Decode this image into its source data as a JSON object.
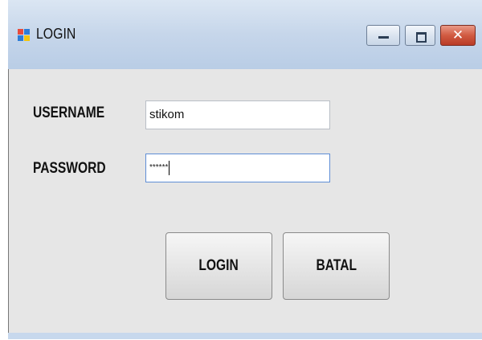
{
  "window": {
    "title": "LOGIN"
  },
  "form": {
    "username_label": "USERNAME",
    "username_value": "stikom",
    "password_label": "PASSWORD",
    "password_mask": "******"
  },
  "buttons": {
    "login_label": "LOGIN",
    "cancel_label": "BATAL"
  },
  "title_controls": {
    "close_glyph": "✕"
  },
  "colors": {
    "client_bg": "#e6e6e6",
    "titlebar": "#c6d6ea",
    "close_button": "#d15b42"
  }
}
